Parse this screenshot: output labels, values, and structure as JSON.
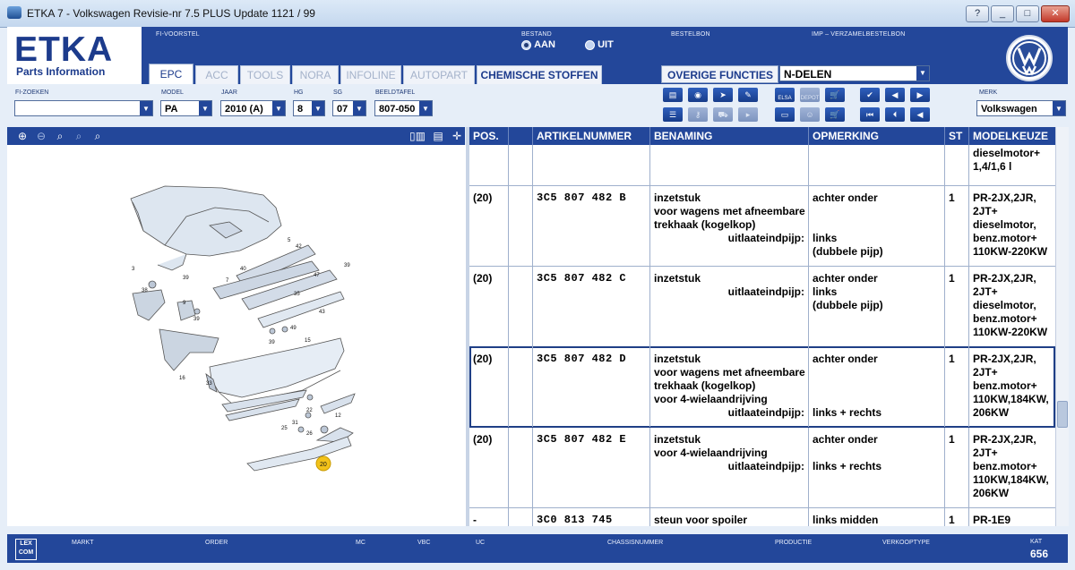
{
  "window": {
    "title": "ETKA 7 - Volkswagen Revisie-nr 7.5 PLUS Update 1121 / 99",
    "buttons": [
      "?",
      "_",
      "□",
      "✕"
    ]
  },
  "header": {
    "logo_main": "ETKA",
    "logo_sub": "Parts Information",
    "fi_voorstel_label": "FI-VOORSTEL",
    "bestand_label": "BESTAND",
    "bestand_on": "AAN",
    "bestand_off": "UIT",
    "bestand_value": "AAN",
    "bestelbon_label": "BESTELBON",
    "imp_label": "IMP – VERZAMELBESTELBON"
  },
  "tabs": [
    "EPC",
    "ACC",
    "TOOLS",
    "NORA",
    "INFOLINE",
    "AUTOPART",
    "CHEMISCHE STOFFEN"
  ],
  "active_tab": "EPC",
  "overige": {
    "label": "OVERIGE FUNCTIES ▸",
    "value": "N-DELEN"
  },
  "selectors": {
    "fi_zoeken": {
      "label": "FI-ZOEKEN",
      "value": ""
    },
    "model": {
      "label": "MODEL",
      "value": "PA"
    },
    "jaar": {
      "label": "JAAR",
      "value": "2010 (A)"
    },
    "hg": {
      "label": "HG",
      "value": "8"
    },
    "sg": {
      "label": "SG",
      "value": "07"
    },
    "beeldtafel": {
      "label": "BEELDTAFEL",
      "value": "807-050"
    },
    "merk": {
      "label": "MERK",
      "value": "Volkswagen"
    }
  },
  "toolbar_icons": {
    "elsa_label": "ELSA",
    "depot_label": "DEPOT"
  },
  "diagram": {
    "callouts": [
      "5",
      "42",
      "3",
      "40",
      "39",
      "47",
      "7",
      "35",
      "39",
      "38",
      "9",
      "39",
      "43",
      "49",
      "39",
      "15",
      "16",
      "33",
      "22",
      "12",
      "31",
      "25",
      "26",
      "20"
    ],
    "highlighted": "20"
  },
  "table": {
    "columns": [
      "POS.",
      "",
      "ARTIKELNUMMER",
      "BENAMING",
      "OPMERKING",
      "ST",
      "MODELKEUZE"
    ],
    "rows": [
      {
        "pos": "",
        "artnr": "",
        "benaming": [],
        "opmerking": [],
        "st": "",
        "model": [
          "dieselmotor+",
          "1,4/1,6 l"
        ]
      },
      {
        "pos": "(20)",
        "artnr": "3C5 807 482 B",
        "benaming": [
          "inzetstuk",
          "voor wagens met afneembare",
          "trekhaak (kogelkop)",
          "uitlaateindpijp:"
        ],
        "opmerking": [
          "achter onder",
          "",
          "",
          "links",
          "(dubbele pijp)"
        ],
        "st": "1",
        "model": [
          "PR-2JX,2JR,",
          "2JT+",
          "dieselmotor,",
          "benz.motor+",
          "110KW-220KW"
        ]
      },
      {
        "pos": "(20)",
        "artnr": "3C5 807 482 C",
        "benaming": [
          "inzetstuk",
          "uitlaateindpijp:"
        ],
        "opmerking": [
          "achter onder",
          "links",
          "(dubbele pijp)"
        ],
        "st": "1",
        "model": [
          "PR-2JX,2JR,",
          "2JT+",
          "dieselmotor,",
          "benz.motor+",
          "110KW-220KW"
        ]
      },
      {
        "pos": "(20)",
        "artnr": "3C5 807 482 D",
        "benaming": [
          "inzetstuk",
          "voor wagens met afneembare",
          "trekhaak (kogelkop)",
          "voor 4-wielaandrijving",
          "uitlaateindpijp:"
        ],
        "opmerking": [
          "achter onder",
          "",
          "",
          "",
          "links + rechts"
        ],
        "st": "1",
        "model": [
          "PR-2JX,2JR,",
          "2JT+",
          "benz.motor+",
          "110KW,184KW,",
          "206KW"
        ]
      },
      {
        "pos": "(20)",
        "artnr": "3C5 807 482 E",
        "benaming": [
          "inzetstuk",
          "voor 4-wielaandrijving",
          "uitlaateindpijp:"
        ],
        "opmerking": [
          "achter onder",
          "",
          "links + rechts"
        ],
        "st": "1",
        "model": [
          "PR-2JX,2JR,",
          "2JT+",
          "benz.motor+",
          "110KW,184KW,",
          "206KW"
        ]
      },
      {
        "pos": "-",
        "artnr": "3C0 813 745",
        "benaming": [
          "steun voor spoiler"
        ],
        "opmerking": [
          "links midden"
        ],
        "st": "1",
        "model": [
          "PR-1E9"
        ]
      }
    ],
    "selected_row": 3
  },
  "bottom": {
    "labels": [
      "MARKT",
      "ORDER",
      "MC",
      "VBC",
      "UC",
      "CHASSISNUMMER",
      "PRODUCTIE",
      "VERKOOPTYPE"
    ],
    "lexcom": "LEX COM",
    "kat_label": "KAT",
    "kat_value": "656"
  },
  "colors": {
    "brand_blue": "#23479a",
    "highlight_yellow": "#f2c21a"
  }
}
